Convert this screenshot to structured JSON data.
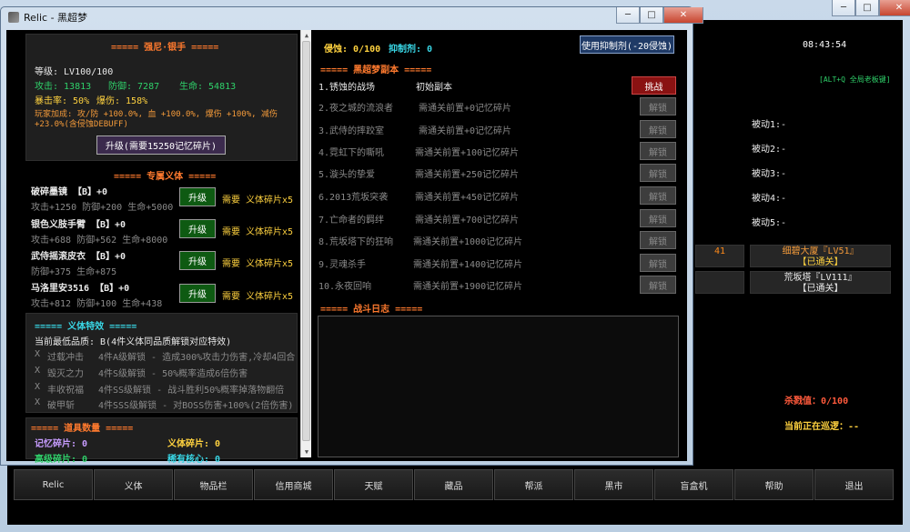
{
  "main_window": {
    "title_partial": "",
    "controls": {
      "minimize": "─",
      "maximize": "□",
      "close": "✕"
    }
  },
  "game": {
    "clock": "08:43:54",
    "hint": "[ALT+Q 全局老板键]",
    "passives": [
      "被动1:-",
      "被动2:-",
      "被动3:-",
      "被动4:-",
      "被动5:-"
    ],
    "cards": [
      {
        "title": "细碧大厦『LV51』",
        "status": "【已通关】"
      },
      {
        "title": "荒坂塔『LV111』",
        "status": "【已通关】"
      }
    ],
    "left_card_fragment": "41",
    "kill_value": "杀戮值：0/100",
    "patrol": "当前正在巡逻：--"
  },
  "bottom_bar": [
    "Relic",
    "义体",
    "物品栏",
    "信用商城",
    "天赋",
    "藏品",
    "帮派",
    "黑市",
    "盲盒机",
    "帮助",
    "退出"
  ],
  "dialog": {
    "title": "Relic - 黑超梦",
    "controls": {
      "minimize": "─",
      "maximize": "□",
      "close": "✕"
    },
    "character": {
      "header": "===== 强尼·银手 =====",
      "level": "等级: LV100/100",
      "attack": "攻击: 13813",
      "defense": "防御: 7287",
      "hp": "生命: 54813",
      "crit": "暴击率: 50%",
      "crit_dmg": "爆伤: 158%",
      "bonus_1": "玩家加成: 攻/防 +100.0%, 血 +100.0%, 爆伤 +100%, 减伤",
      "bonus_2": "+23.0%(含侵蚀DEBUFF)",
      "upgrade_button": "升级(需要15250记忆碎片)"
    },
    "implants": {
      "header": "===== 专属义体 =====",
      "items": [
        {
          "name": "破碎墨镜 【B】+0",
          "stats": "攻击+1250 防御+200 生命+5000",
          "button": "升级",
          "need": "需要",
          "cost": "义体碎片x5"
        },
        {
          "name": "银色义肢手臂 【B】+0",
          "stats": "攻击+688 防御+562 生命+8000",
          "button": "升级",
          "need": "需要",
          "cost": "义体碎片x5"
        },
        {
          "name": "武侍摇滚皮衣 【B】+0",
          "stats": "防御+375 生命+875",
          "button": "升级",
          "need": "需要",
          "cost": "义体碎片x5"
        },
        {
          "name": "马洛里安3516 【B】+0",
          "stats": "攻击+812 防御+100 生命+438",
          "button": "升级",
          "need": "需要",
          "cost": "义体碎片x5"
        }
      ]
    },
    "traits": {
      "header": "===== 义体特效 =====",
      "min_quality": "当前最低品质: B(4件义体同品质解锁对应特效)",
      "items": [
        {
          "mark": "X",
          "name": "过载冲击",
          "desc": "4件A级解锁 - 造成300%攻击力伤害,冷却4回合"
        },
        {
          "mark": "X",
          "name": "毁灭之力",
          "desc": "4件S级解锁 - 50%概率造成6倍伤害"
        },
        {
          "mark": "X",
          "name": "丰收祝福",
          "desc": "4件SS级解锁 - 战斗胜利50%概率掉落物翻倍"
        },
        {
          "mark": "X",
          "name": "破甲斩",
          "desc": "4件SSS级解锁 - 对BOSS伤害+100%(2倍伤害)"
        }
      ]
    },
    "items": {
      "header": "===== 道具数量 =====",
      "memory_shard": "记忆碎片: 0",
      "implant_shard": "义体碎片: 0",
      "advanced_shard": "高级碎片: 0",
      "rare_core": "稀有核心: 0"
    },
    "status": {
      "corrosion": "侵蚀: 0/100",
      "inhibitor": "抑制剂: 0",
      "use_button": "使用抑制剂(-20侵蚀)"
    },
    "dungeons": {
      "header": "===== 黑超梦副本 =====",
      "rows": [
        {
          "name": "1.锈蚀的战场",
          "req": "初始副本",
          "button": "挑战",
          "unlocked": true
        },
        {
          "name": "2.夜之城的流浪者",
          "req": "需通关前置+0记忆碎片",
          "button": "解锁",
          "unlocked": false
        },
        {
          "name": "3.武侍的摔跤室",
          "req": "需通关前置+0记忆碎片",
          "button": "解锁",
          "unlocked": false
        },
        {
          "name": "4.霓虹下的嘶吼",
          "req": "需通关前置+100记忆碎片",
          "button": "解锁",
          "unlocked": false
        },
        {
          "name": "5.漩头的挚爱",
          "req": "需通关前置+250记忆碎片",
          "button": "解锁",
          "unlocked": false
        },
        {
          "name": "6.2013荒坂突袭",
          "req": "需通关前置+450记忆碎片",
          "button": "解锁",
          "unlocked": false
        },
        {
          "name": "7.亡命者的羁绊",
          "req": "需通关前置+700记忆碎片",
          "button": "解锁",
          "unlocked": false
        },
        {
          "name": "8.荒坂塔下的狂响",
          "req": "需通关前置+1000记忆碎片",
          "button": "解锁",
          "unlocked": false
        },
        {
          "name": "9.灵魂杀手",
          "req": "需通关前置+1400记忆碎片",
          "button": "解锁",
          "unlocked": false
        },
        {
          "name": "10.永夜回响",
          "req": "需通关前置+1900记忆碎片",
          "button": "解锁",
          "unlocked": false
        }
      ]
    },
    "battle_log": {
      "header": "===== 战斗日志 ====="
    }
  }
}
